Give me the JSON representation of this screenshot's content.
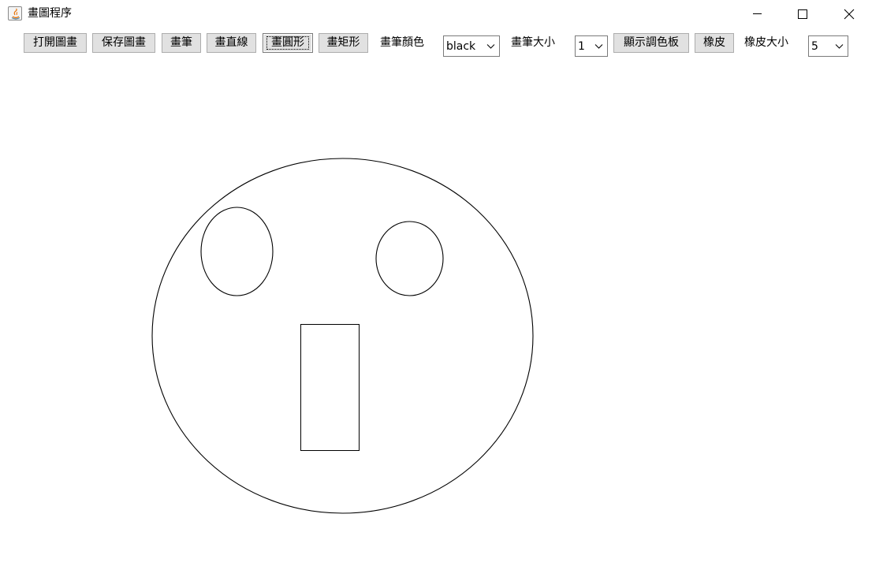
{
  "window": {
    "title": "畫圖程序",
    "app_icon": "java-app-icon",
    "controls": [
      "minimize-icon",
      "maximize-icon",
      "close-icon"
    ]
  },
  "toolbar": {
    "open_label": "打開圖畫",
    "save_label": "保存圖畫",
    "pen_label": "畫筆",
    "line_label": "畫直線",
    "circle_label": "畫圓形",
    "rect_label": "畫矩形",
    "pen_color_label": "畫筆顏色",
    "pen_color_value": "black",
    "pen_size_label": "畫筆大小",
    "pen_size_value": "1",
    "palette_label": "顯示調色板",
    "eraser_label": "橡皮",
    "eraser_size_label": "橡皮大小",
    "eraser_size_value": "5",
    "active_tool": "畫圓形"
  },
  "canvas": {
    "background": "#ffffff",
    "stroke_color": "#000000",
    "shapes": [
      "face-ellipse",
      "left-eye-ellipse",
      "right-eye-ellipse",
      "mouth-rectangle"
    ]
  }
}
